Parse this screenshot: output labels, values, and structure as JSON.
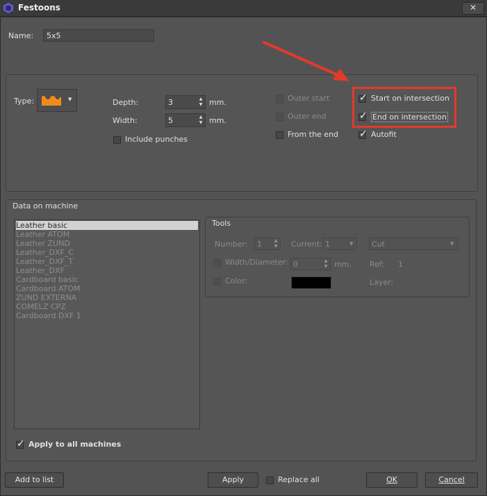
{
  "window": {
    "title": "Festoons",
    "close_label": "✕"
  },
  "name": {
    "label": "Name:",
    "value": "5x5"
  },
  "type_section": {
    "type_label": "Type:",
    "depth_label": "Depth:",
    "depth_value": "3",
    "depth_unit": "mm.",
    "width_label": "Width:",
    "width_value": "5",
    "width_unit": "mm.",
    "include_punches_label": "Include punches",
    "outer_start_label": "Outer start",
    "outer_end_label": "Outer end",
    "from_the_end_label": "From the end",
    "start_on_intersection_label": "Start on intersection",
    "end_on_intersection_label": "End on intersection",
    "autofit_label": "Autofit",
    "check_glyph": "✓"
  },
  "machines": {
    "group_label": "Data on machine",
    "items": [
      "Leather basic",
      "Leather ATOM",
      "Leather ZUND",
      "Leather_DXF_C",
      "Leather_DXF_T",
      "Leather_DXF",
      "Cardboard basic",
      "Cardboard ATOM",
      "ZUND EXTERNA",
      "COMELZ CPZ",
      "Cardboard DXF 1"
    ],
    "selected": "Leather basic",
    "apply_all_label": "Apply to all machines"
  },
  "tools": {
    "group_label": "Tools",
    "number_label": "Number:",
    "number_value": "1",
    "current_label": "Current:",
    "current_value": "1",
    "operation_value": "Cut",
    "width_diameter_label": "Width/Diameter:",
    "width_diameter_value": "0",
    "width_diameter_unit": "mm.",
    "ref_label": "Ref:",
    "ref_value": "1",
    "color_label": "Color:",
    "color_swatch": "#000000",
    "layer_label": "Layer:"
  },
  "footer": {
    "add_to_list_label": "Add to list",
    "apply_label": "Apply",
    "replace_all_label": "Replace all",
    "ok_label": "OK",
    "cancel_label": "Cancel"
  },
  "annotation": {
    "color": "#e23a2b"
  }
}
